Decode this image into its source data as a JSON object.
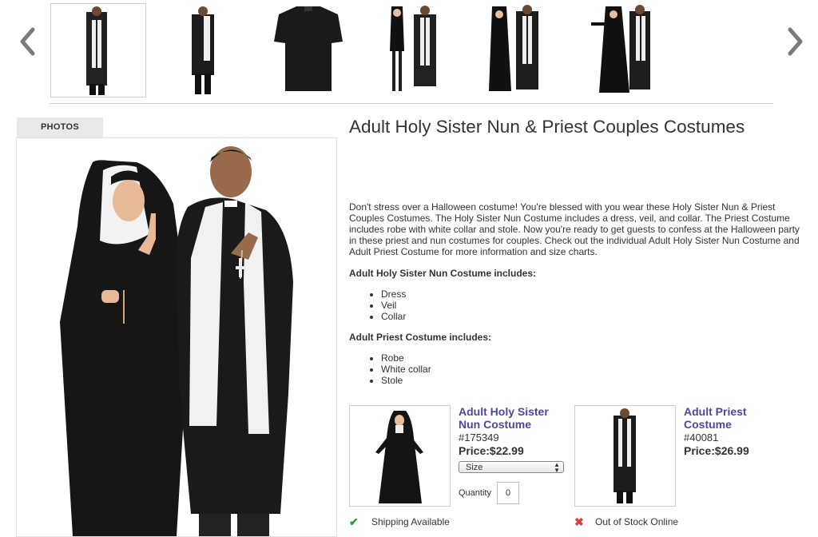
{
  "carousel": {
    "thumbnails": [
      {
        "name": "nun-priest-couple-thumb"
      },
      {
        "name": "priest-costume-thumb"
      },
      {
        "name": "black-clergy-shirt-thumb"
      },
      {
        "name": "sexy-nun-priest-thumb"
      },
      {
        "name": "nun-priest-pair-thumb"
      },
      {
        "name": "nun-priest-couple-alt-thumb"
      }
    ]
  },
  "photos": {
    "tab_label": "PHOTOS"
  },
  "product": {
    "title": "Adult Holy Sister Nun & Priest Couples Costumes",
    "description": "Don't stress over a Halloween costume! You're blessed with you wear these Holy Sister Nun & Priest Couples Costumes. The Holy Sister Nun Costume includes a dress, veil, and collar. The Priest Costume includes robe with white collar and stole. Now you're ready to get guests to confess at the Halloween party in these priest and nun costumes for couples. Check out the individual Adult Holy Sister Nun Costume and Adult Priest Costume for more information and size charts.",
    "nun_heading": "Adult Holy Sister Nun Costume includes:",
    "nun_items": [
      "Dress",
      "Veil",
      "Collar"
    ],
    "priest_heading": "Adult Priest Costume includes:",
    "priest_items": [
      "Robe",
      "White collar",
      "Stole"
    ]
  },
  "components": [
    {
      "name_line1": "Adult Holy Sister",
      "name_line2": "Nun Costume",
      "sku": "#175349",
      "price": "Price:$22.99",
      "size_placeholder": "Size",
      "quantity_label": "Quantity",
      "quantity_value": "0",
      "status": "Shipping Available",
      "status_color": "#2e9c3a"
    },
    {
      "name_line1": "Adult Priest",
      "name_line2": "Costume",
      "sku": "#40081",
      "price": "Price:$26.99",
      "status": "Out of Stock Online",
      "status_color": "#d9403b"
    }
  ],
  "colors": {
    "link": "#4a4a9c",
    "border": "#cfcfcf"
  }
}
